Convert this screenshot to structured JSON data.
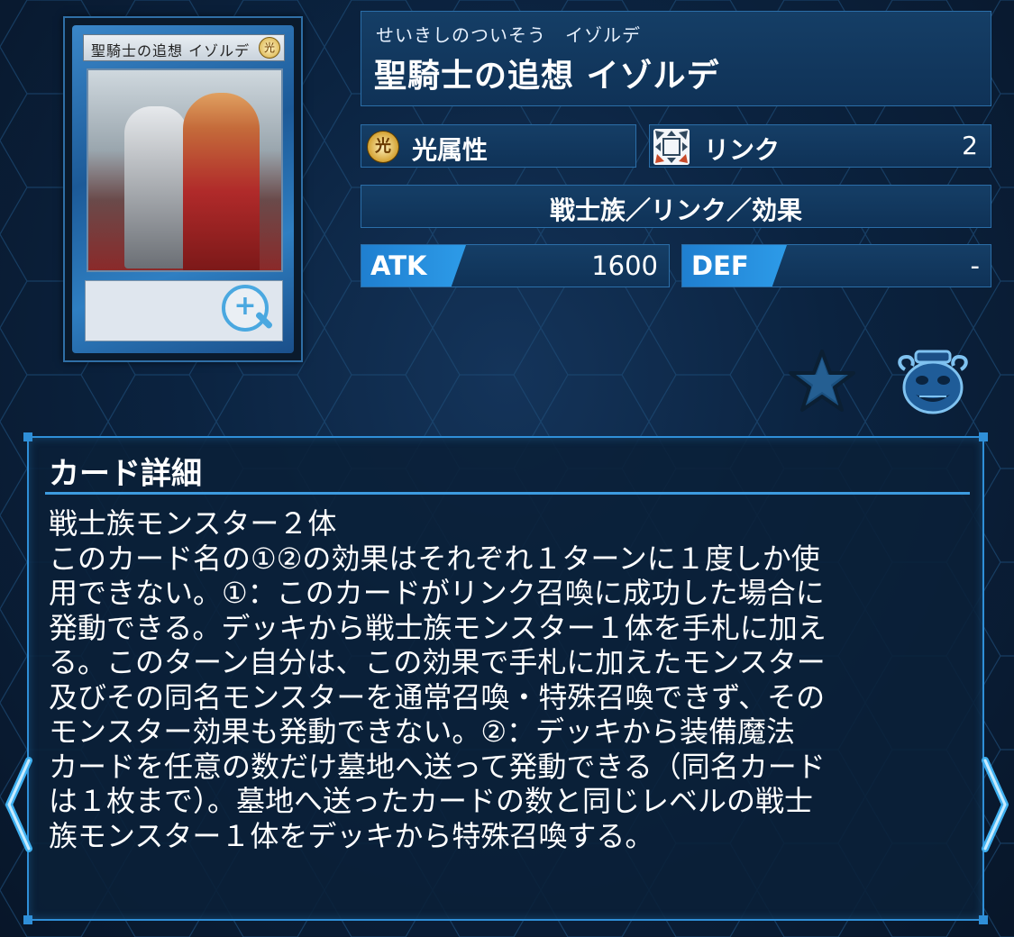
{
  "card": {
    "ruby": "せいきしのついそう　イゾルデ",
    "name": "聖騎士の追想 イゾルデ",
    "image_name_text": "聖騎士の追想 イゾルデ",
    "attribute_icon_char": "光",
    "attribute": "光属性",
    "link_label": "リンク",
    "link_value": "2",
    "type_line": "戦士族／リンク／効果",
    "atk_label": "ATK",
    "atk_value": "1600",
    "def_label": "DEF",
    "def_value": "-"
  },
  "detail": {
    "heading": "カード詳細",
    "lines": [
      "戦士族モンスター２体",
      "このカード名の①②の効果はそれぞれ１ターンに１度しか使",
      "用できない。①：このカードがリンク召喚に成功した場合に",
      "発動できる。デッキから戦士族モンスター１体を手札に加え",
      "る。このターン自分は、この効果で手札に加えたモンスター",
      "及びその同名モンスターを通常召喚・特殊召喚できず、その",
      "モンスター効果も発動できない。②：デッキから装備魔法",
      "カードを任意の数だけ墓地へ送って発動できる（同名カード",
      "は１枚まで）。墓地へ送ったカードの数と同じレベルの戦士",
      "族モンスター１体をデッキから特殊召喚する。"
    ]
  },
  "icons": {
    "zoom": "zoom-in-icon",
    "favorite": "star-icon",
    "pot": "pot-of-greed-icon",
    "prev": "chevron-left-icon",
    "next": "chevron-right-icon",
    "link_arrows": "link-arrows-icon",
    "attribute": "light-attribute-icon"
  },
  "colors": {
    "accent": "#2f8fd8",
    "panel": "#153e66",
    "stat_tag": "#2d9be8"
  }
}
